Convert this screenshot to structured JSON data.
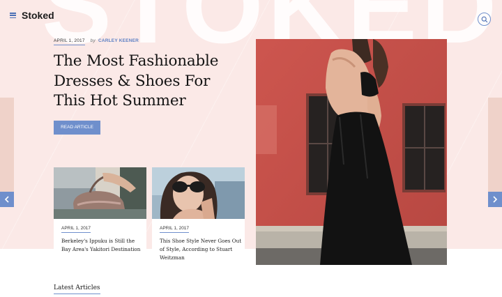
{
  "brand": {
    "name": "Stoked",
    "watermark": "STOKED"
  },
  "hero": {
    "date": "APRIL 1, 2017",
    "by": "by",
    "author": "CARLEY KEENER",
    "headline": "The Most Fashionable Dresses & Shoes For This Hot Summer",
    "button": "READ ARTICLE"
  },
  "cards": [
    {
      "date": "APRIL 1, 2017",
      "title": "Berkeley's Ippuku is Still the Bay Area's Yakitori Destination"
    },
    {
      "date": "APRIL 1, 2017",
      "title": "This Shoe Style Never Goes Out of Style, According to Stuart Weitzman"
    }
  ],
  "sections": {
    "latest": "Latest Articles"
  },
  "colors": {
    "accent": "#6f8fcc",
    "hero_background": "#fbe9e7",
    "feature_wall": "#c8504a"
  },
  "icons": [
    "menu-icon",
    "search-icon",
    "chevron-left-icon",
    "chevron-right-icon"
  ]
}
